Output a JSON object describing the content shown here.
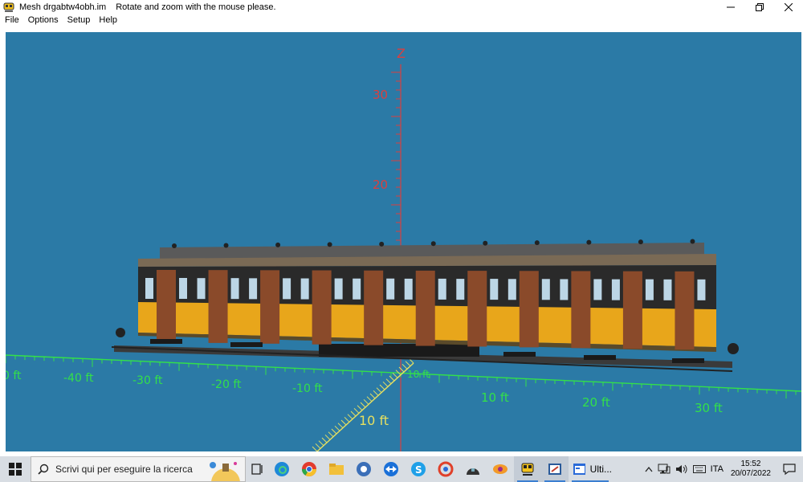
{
  "window": {
    "title": "Mesh drgabtw4obh.im",
    "hint": "Rotate and zoom with the mouse please."
  },
  "menu": [
    {
      "label": "File"
    },
    {
      "label": "Options"
    },
    {
      "label": "Setup"
    },
    {
      "label": "Help"
    }
  ],
  "viewer": {
    "background": "#2b7aa6",
    "z_axis_label": "Z",
    "z_axis_color": "#d84040",
    "grid_color": "#33e04a",
    "z_ticks": [
      "30",
      "20",
      "10"
    ],
    "x_ticks": [
      "-50 ft",
      "-40 ft",
      "-30 ft",
      "-20 ft",
      "-10 ft",
      "10 ft",
      "20 ft",
      "30 ft"
    ],
    "x_tick_labels_visible": [
      "0 ft",
      "-40 ft",
      "-30 ft",
      "-20 ft",
      "-10 ft",
      "10 ft",
      "20 ft",
      "30 ft"
    ],
    "y_ticks": [
      "10 ft",
      "10 ft"
    ],
    "model": "railway coach (yellow/brown livery)"
  },
  "taskbar": {
    "search_placeholder": "Scrivi qui per eseguire la ricerca",
    "running_app_label": "Ulti...",
    "language": "ITA",
    "time": "15:52",
    "date": "20/07/2022"
  }
}
